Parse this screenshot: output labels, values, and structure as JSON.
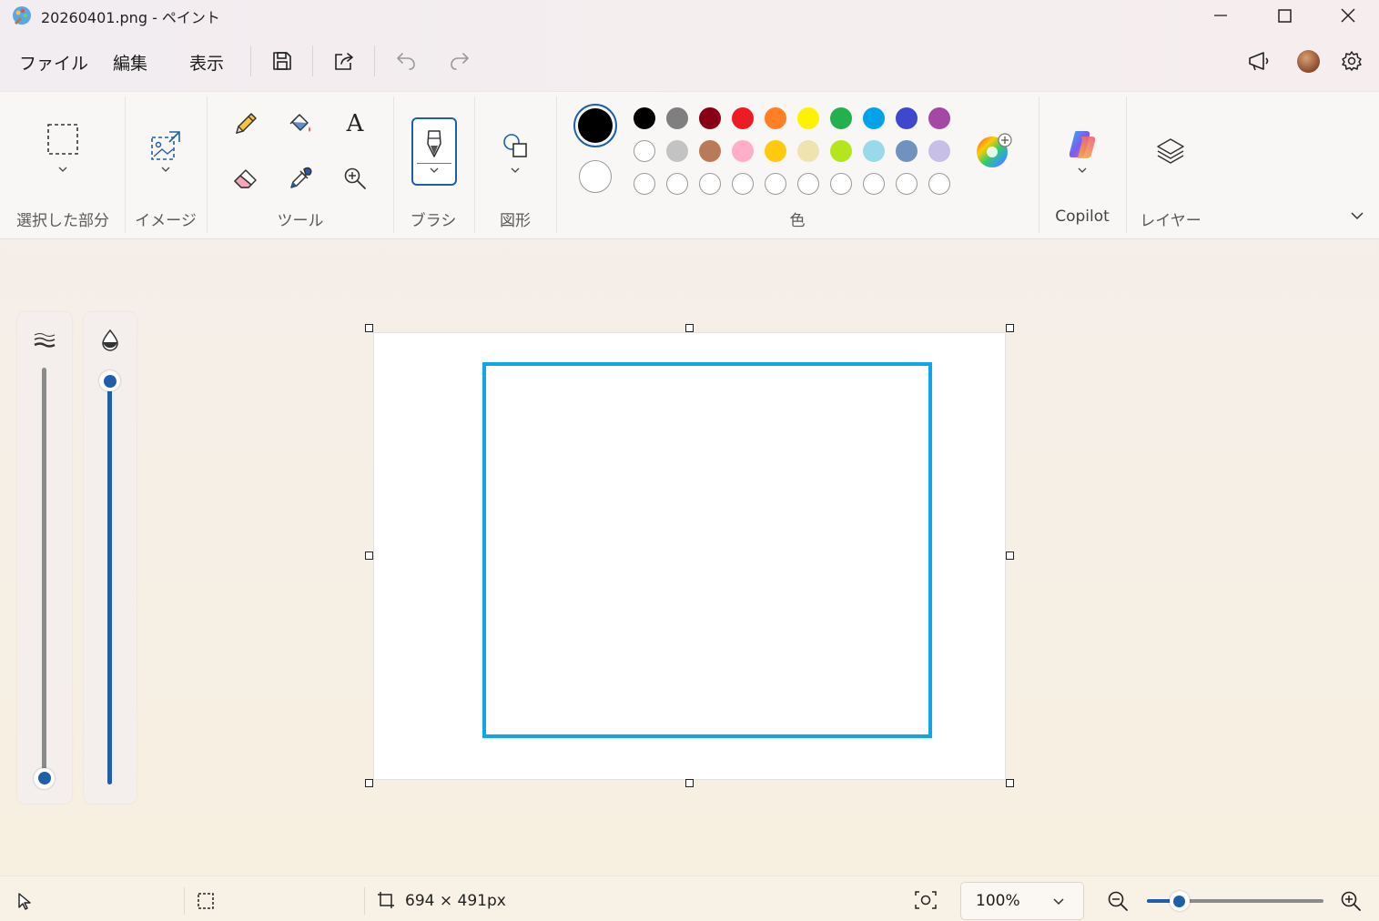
{
  "window": {
    "title": "20260401.png - ペイント",
    "app_icon": "paint-palette-icon",
    "controls": [
      "minimize-icon",
      "maximize-icon",
      "close-icon"
    ]
  },
  "menu": {
    "items": [
      "ファイル",
      "編集",
      "表示"
    ],
    "quick_actions": [
      "save-icon",
      "share-icon",
      "undo-icon",
      "redo-icon"
    ],
    "right_actions": [
      "announcement-icon",
      "avatar",
      "gear-icon"
    ]
  },
  "ribbon": {
    "groups": {
      "selection": "選択した部分",
      "image": "イメージ",
      "tools": "ツール",
      "brush": "ブラシ",
      "shapes": "図形",
      "colors": "色",
      "copilot": "Copilot",
      "layers": "レイヤー"
    },
    "tools": [
      "pencil-icon",
      "fill-bucket-icon",
      "text-icon",
      "eraser-icon",
      "color-picker-icon",
      "magnifier-icon"
    ],
    "text_tool_glyph": "A",
    "colors": {
      "primary": "#000000",
      "secondary": "#ffffff",
      "row1": [
        "#000000",
        "#7f7f7f",
        "#880015",
        "#ed1c24",
        "#ff7f27",
        "#fff200",
        "#22b14c",
        "#00a2e8",
        "#3f48cc",
        "#a349a4"
      ],
      "row2": [
        "#ffffff",
        "#c3c3c3",
        "#b97a57",
        "#ffaec9",
        "#ffc90e",
        "#efe4b0",
        "#b5e61d",
        "#99d9ea",
        "#7092be",
        "#c8bfe7"
      ],
      "row3_custom_slots": 10
    }
  },
  "side_sliders": {
    "size": {
      "icon": "stroke-size-icon",
      "value_fraction": 0.02
    },
    "opacity": {
      "icon": "opacity-drop-icon",
      "value_fraction": 1.0
    }
  },
  "canvas": {
    "background": "#ffffff",
    "rect_stroke_color": "#0ea5e9"
  },
  "status": {
    "pointer_icon": "cursor-icon",
    "selection_icon": "selection-size-icon",
    "canvas_size": "694 × 491px",
    "fit_icon": "fit-to-window-icon",
    "zoom_value": "100%",
    "zoom_slider_fraction": 0.08
  }
}
